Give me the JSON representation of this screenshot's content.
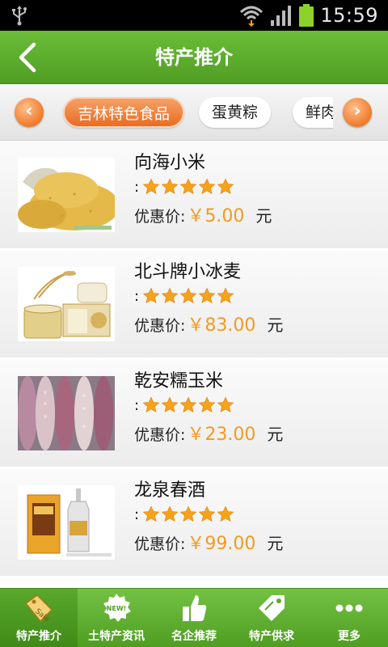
{
  "status_bar": {
    "time": "15:59",
    "icons": [
      "usb-icon",
      "wifi-icon",
      "signal-icon",
      "battery-icon"
    ]
  },
  "header": {
    "title": "特产推介",
    "back_icon": "back-arrow-icon"
  },
  "categories": {
    "items": [
      {
        "label": "吉林特色食品",
        "active": true
      },
      {
        "label": "蛋黄粽",
        "active": false
      },
      {
        "label": "鲜肉",
        "active": false
      }
    ],
    "prev_icon": "chevron-left-icon",
    "next_icon": "chevron-right-icon"
  },
  "products": [
    {
      "name": "向海小米",
      "rating_prefix": ":",
      "stars": 5,
      "price_label": "优惠价:",
      "price": "￥5.00",
      "unit": "元"
    },
    {
      "name": "北斗牌小冰麦",
      "rating_prefix": ":",
      "stars": 5,
      "price_label": "优惠价:",
      "price": "￥83.00",
      "unit": "元"
    },
    {
      "name": "乾安糯玉米",
      "rating_prefix": ":",
      "stars": 5,
      "price_label": "优惠价:",
      "price": "￥23.00",
      "unit": "元"
    },
    {
      "name": "龙泉春酒",
      "rating_prefix": ":",
      "stars": 5,
      "price_label": "优惠价:",
      "price": "￥99.00",
      "unit": "元"
    }
  ],
  "tabs": [
    {
      "label": "特产推介",
      "icon": "sale-tag-icon",
      "active": true
    },
    {
      "label": "土特产资讯",
      "icon": "new-badge-icon",
      "active": false
    },
    {
      "label": "名企推荐",
      "icon": "thumbs-up-icon",
      "active": false
    },
    {
      "label": "特产供求",
      "icon": "price-tag-icon",
      "active": false
    },
    {
      "label": "更多",
      "icon": "more-dots-icon",
      "active": false
    }
  ],
  "colors": {
    "accent_green": "#5bab2c",
    "accent_orange": "#ee7b2d",
    "price_orange": "#f39a1e"
  }
}
